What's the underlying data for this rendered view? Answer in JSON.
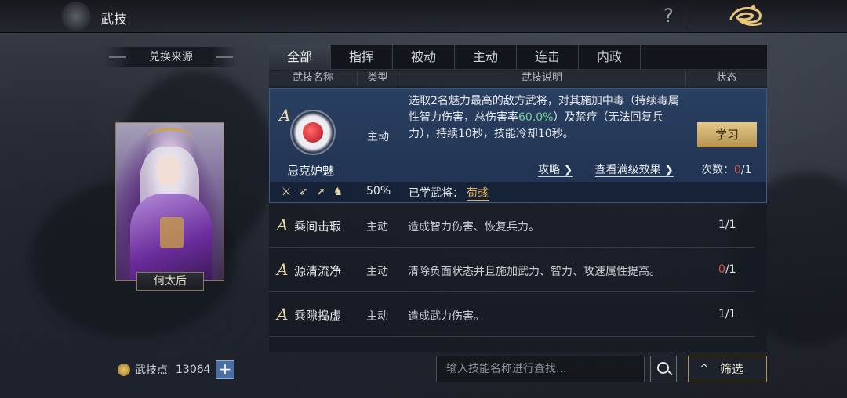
{
  "header": {
    "title": "武技",
    "help": "?"
  },
  "left": {
    "source_title": "兑换来源",
    "general_name": "何太后",
    "points_label": "武技点",
    "points_value": "13064",
    "plus": "+"
  },
  "tabs": [
    "全部",
    "指挥",
    "被动",
    "主动",
    "连击",
    "内政"
  ],
  "active_tab": 0,
  "columns": {
    "name": "武技名称",
    "type": "类型",
    "desc": "武技说明",
    "status": "状态"
  },
  "selected_skill": {
    "grade": "A",
    "name": "忌克妒魅",
    "type": "主动",
    "desc_1": "选取2名魅力最高的敌方武将，对其施加中毒（持续毒属性智力伤害，总伤害率",
    "desc_highlight": "60.0%",
    "desc_2": "）及禁疗（无法回复兵力），持续10秒，技能冷却10秒。",
    "learn": "学习",
    "strategy_link": "攻略 ❯",
    "maxlevel_link": "查看满级效果 ❯",
    "count_label": "次数：",
    "count_used": "0",
    "count_total": "/1",
    "rate": "50%",
    "learned_label": "已学武将：",
    "learned_general": "荀彧",
    "weapons": [
      "sword-icon",
      "bow-icon",
      "spear-icon",
      "horse-icon"
    ]
  },
  "skills": [
    {
      "grade": "A",
      "name": "乘间击瑕",
      "type": "主动",
      "desc": "造成智力伤害、恢复兵力。",
      "count_used": "1",
      "count_total": "/1"
    },
    {
      "grade": "A",
      "name": "源清流净",
      "type": "主动",
      "desc": "清除负面状态并且施加武力、智力、攻速属性提高。",
      "count_used": "0",
      "count_total": "/1"
    },
    {
      "grade": "A",
      "name": "乘隙捣虚",
      "type": "主动",
      "desc": "造成武力伤害。",
      "count_used": "1",
      "count_total": "/1"
    }
  ],
  "search": {
    "placeholder": "输入技能名称进行查找...",
    "filter": "筛选",
    "filter_chevron": "^"
  },
  "colors": {
    "accent_gold": "#b6924e",
    "highlight_green": "#6fd28f",
    "zero_red": "#e0554f",
    "selected_row": "#2a4061"
  }
}
